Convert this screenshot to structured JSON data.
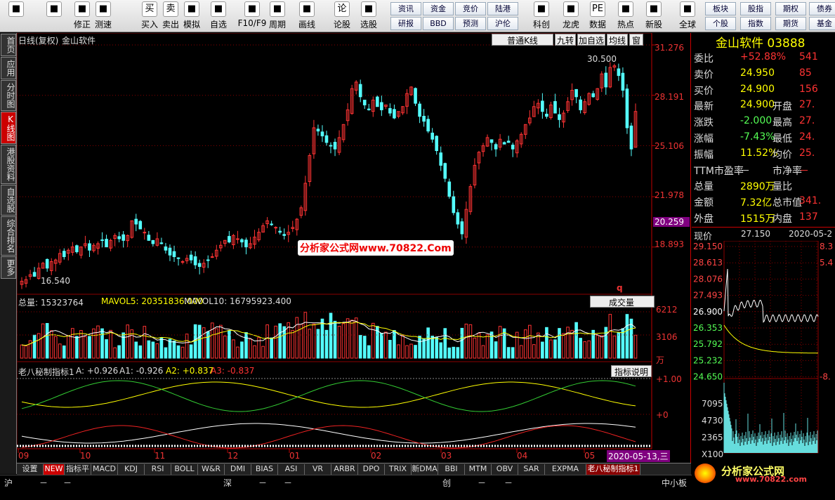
{
  "toolbar": {
    "big": [
      {
        "label": "",
        "icon": "windows-logo"
      },
      {
        "label": "",
        "icon": "back-arrow"
      },
      {
        "label": "修正",
        "icon": "updown-arrows"
      },
      {
        "label": "测速",
        "icon": "speed-icon"
      },
      {
        "label": "买入",
        "icon": "buy-icon",
        "glyph": "买"
      },
      {
        "label": "卖出",
        "icon": "sell-icon",
        "glyph": "卖"
      },
      {
        "label": "模拟",
        "icon": "hammer-icon"
      },
      {
        "label": "自选",
        "icon": "star-icon"
      },
      {
        "label": "F10/F9",
        "icon": "f10-icon"
      },
      {
        "label": "周期",
        "icon": "clock-icon"
      },
      {
        "label": "画线",
        "icon": "pen-icon"
      },
      {
        "label": "论股",
        "icon": "discuss-icon",
        "glyph": "论"
      },
      {
        "label": "选股",
        "icon": "chart-icon"
      },
      {
        "label": "科创",
        "icon": "kechuang-icon"
      },
      {
        "label": "龙虎",
        "icon": "dragon-icon"
      },
      {
        "label": "数据",
        "icon": "pe-icon",
        "glyph": "PE"
      },
      {
        "label": "热点",
        "icon": "hot-icon"
      },
      {
        "label": "新股",
        "icon": "ipo-icon"
      },
      {
        "label": "全球",
        "icon": "globe-icon"
      }
    ],
    "small": [
      "资讯",
      "资金",
      "竞价",
      "陆港",
      "研报",
      "BBD",
      "预测",
      "沪伦",
      "板块",
      "股指",
      "期权",
      "债券",
      "个股",
      "指数",
      "期货",
      "基金"
    ]
  },
  "left_tabs": [
    "首页",
    "应用",
    "分时图",
    "K线图",
    "港股资料",
    "自选股",
    "综合排名",
    "更多"
  ],
  "chart": {
    "title": "日线(复权)",
    "stock": "金山软件",
    "kline_type": "普通K线",
    "btn_jiuzhuan": "九转",
    "btn_add": "加自选",
    "btn_junxian": "均线",
    "btn_window": "窗",
    "high_mark": "30.500",
    "low_mark": "16.540",
    "current_price": "20.259",
    "price_axis": [
      "31.276",
      "28.191",
      "25.106",
      "21.978",
      "18.893"
    ],
    "watermark": "分析家公式网www.70822.Com",
    "volume_label": "总量: 15323764",
    "vol_mavol5": "MAVOL5: 20351836.000",
    "vol_mavol10": "MAVOL10: 16795923.400",
    "vol_selector": "成交量",
    "vol_axis": [
      "6212",
      "3106",
      "万"
    ],
    "ind_label": "老八秘制指标1",
    "ind_a": "A: +0.926",
    "ind_a1": "A1: -0.926",
    "ind_a2": "A2: +0.837",
    "ind_a3": "A3: -0.837",
    "ind_btn": "指标说明",
    "ind_axis": [
      "+1.00",
      "+0"
    ],
    "months": [
      "09",
      "10",
      "11",
      "12",
      "01",
      "02",
      "03",
      "04",
      "05"
    ],
    "date_label": "2020-05-13,三",
    "q_marker": "q"
  },
  "chart_data": {
    "type": "candlestick",
    "price_range": [
      16.0,
      31.276
    ],
    "daily_close_approx": [
      16.8,
      16.9,
      17.2,
      17.1,
      17.6,
      17.9,
      17.6,
      18.0,
      18.1,
      18.5,
      18.3,
      18.7,
      18.9,
      18.6,
      18.9,
      19.1,
      18.7,
      19.0,
      19.1,
      19.3,
      18.9,
      19.3,
      19.6,
      19.4,
      19.3,
      19.6,
      20.5,
      20.3,
      20.0,
      19.8,
      19.3,
      19.1,
      19.4,
      19.1,
      18.7,
      18.4,
      18.3,
      18.2,
      18.0,
      18.2,
      18.1,
      17.8,
      17.7,
      17.9,
      18.1,
      18.3,
      18.7,
      19.0,
      19.3,
      19.2,
      19.6,
      19.4,
      19.2,
      18.9,
      19.1,
      19.5,
      19.8,
      20.2,
      20.5,
      20.3,
      20.1,
      19.8,
      19.6,
      19.8,
      20.1,
      20.6,
      21.3,
      22.8,
      24.5,
      26.2,
      26.0,
      25.7,
      25.3,
      25.1,
      24.9,
      25.6,
      26.4,
      27.3,
      28.6,
      29.0,
      28.1,
      27.6,
      27.3,
      27.9,
      27.5,
      27.3,
      27.6,
      27.1,
      26.8,
      27.2,
      27.5,
      28.3,
      28.7,
      27.7,
      26.9,
      26.6,
      26.0,
      25.5,
      24.8,
      23.9,
      23.1,
      22.0,
      21.0,
      20.3,
      19.7,
      21.2,
      22.6,
      23.9,
      24.7,
      25.1,
      25.6,
      25.3,
      24.9,
      25.5,
      25.2,
      25.3,
      24.9,
      25.4,
      25.8,
      26.4,
      26.8,
      27.5,
      27.7,
      27.2,
      26.9,
      27.6,
      27.1,
      26.7,
      27.1,
      27.8,
      28.5,
      28.1,
      27.3,
      27.8,
      28.3,
      28.1,
      28.6,
      29.5,
      28.7,
      29.9,
      30.0,
      29.4,
      28.5,
      26.2,
      24.9,
      27.2
    ]
  },
  "quote": {
    "name": "金山软件",
    "code": "03888",
    "rows": [
      [
        "委比",
        "+52.88%",
        "541"
      ],
      [
        "卖价",
        "24.950",
        "85"
      ],
      [
        "买价",
        "24.900",
        "156"
      ],
      [
        "最新",
        "24.900",
        "开盘",
        "27."
      ],
      [
        "涨跌",
        "-2.000",
        "最高",
        "27."
      ],
      [
        "涨幅",
        "-7.43%",
        "最低",
        "24."
      ],
      [
        "振幅",
        "11.52%",
        "均价",
        "25."
      ],
      [
        "TTM市盈率",
        "－",
        "市净率",
        "－"
      ],
      [
        "总量",
        "2890万",
        "量比",
        ""
      ],
      [
        "金额",
        "7.32亿",
        "总市值",
        "341."
      ],
      [
        "外盘",
        "1515万",
        "内盘",
        "137"
      ]
    ],
    "now_label": "现价",
    "now_price": "27.150",
    "now_date": "2020-05-2",
    "intraday_axis": [
      "29.150",
      "28.613",
      "28.076",
      "27.493",
      "26.900",
      "26.353",
      "25.792",
      "25.232",
      "24.650"
    ],
    "intraday_right": [
      "8.3",
      "5.4",
      "",
      "",
      "",
      "",
      "",
      "",
      "-8."
    ],
    "intraday_vol_axis": [
      "7095",
      "4730",
      "2365",
      "X100"
    ],
    "logo_text": "分析家公式网",
    "logo_url": "www.70822.com"
  },
  "bottom_tabs": [
    "设置",
    "NEW",
    "指标平台",
    "MACD",
    "KDJ",
    "RSI",
    "BOLL",
    "W&R",
    "DMI",
    "BIAS",
    "ASI",
    "VR",
    "ARBR",
    "DPO",
    "TRIX",
    "新DMA",
    "BBI",
    "MTM",
    "OBV",
    "SAR",
    "EXPMA",
    "老八秘制指标1"
  ],
  "status": {
    "labels": [
      "沪",
      "－",
      "－",
      "深",
      "－",
      "－",
      "创",
      "－",
      "－",
      "中小板"
    ]
  },
  "colors": {
    "up": "#ff3333",
    "down": "#54ffff",
    "bg": "#000000",
    "grid": "#8b0000",
    "axis": "#c00000"
  }
}
